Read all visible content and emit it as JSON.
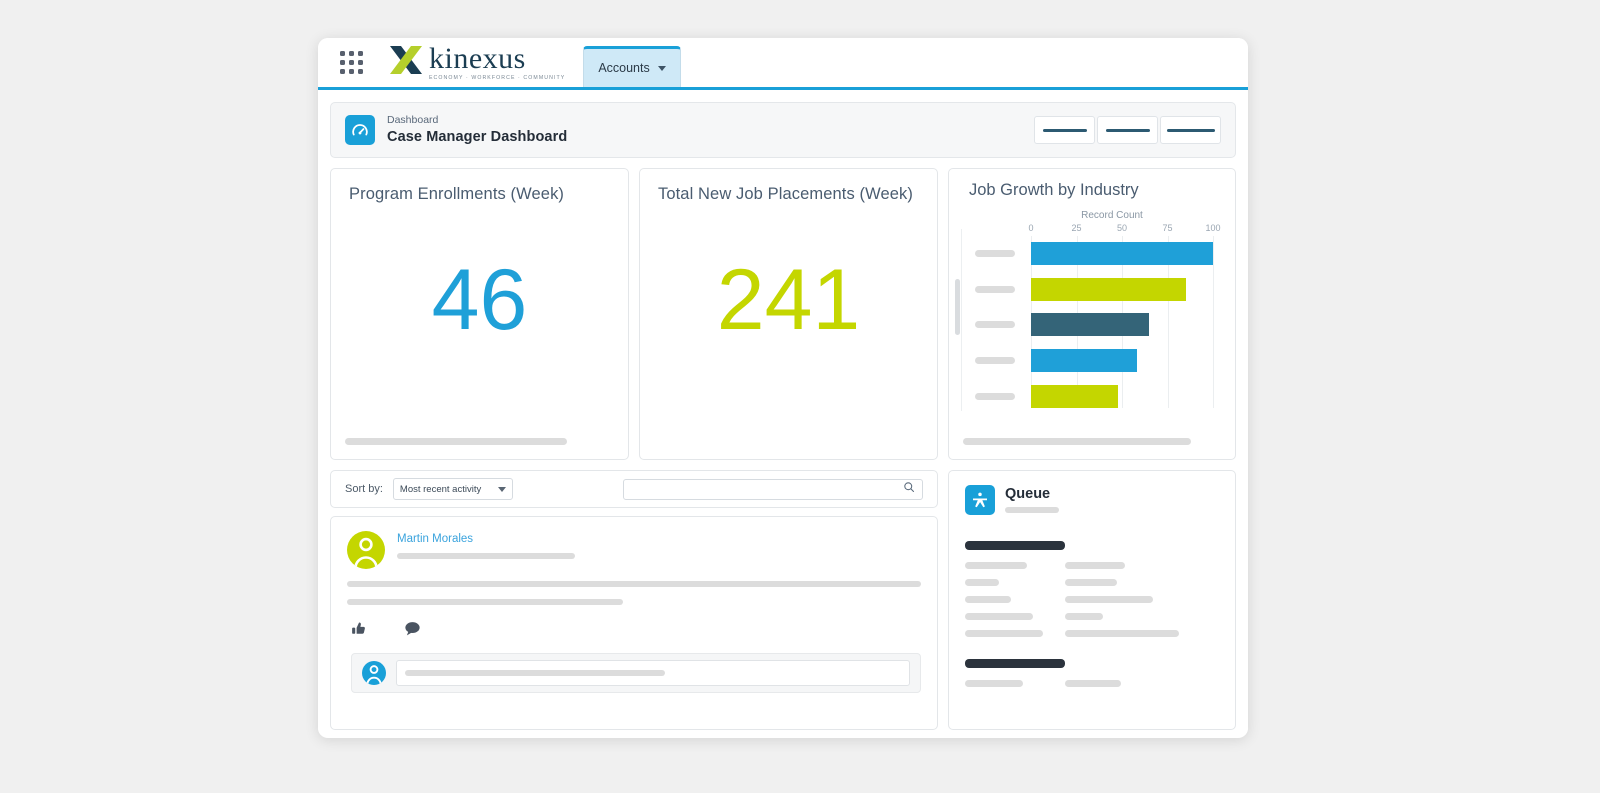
{
  "topbar": {
    "app_launcher_icon": "app-grid-icon",
    "brand_name": "kinexus",
    "brand_tagline": "ECONOMY · WORKFORCE · COMMUNITY",
    "tab_label": "Accounts",
    "tab_chevron_icon": "chevron-down-icon",
    "accent_color": "#19a0d8"
  },
  "dashboard_header": {
    "icon": "gauge-icon",
    "eyebrow": "Dashboard",
    "title": "Case Manager Dashboard",
    "action_buttons": [
      "",
      "",
      ""
    ]
  },
  "kpis": [
    {
      "title": "Program Enrollments (Week)",
      "value": "46",
      "color": "#1fa0d8"
    },
    {
      "title": "Total New Job Placements (Week)",
      "value": "241",
      "color": "#c4d600"
    }
  ],
  "chart_card": {
    "title": "Job Growth by Industry"
  },
  "chart_data": {
    "type": "bar",
    "title": "Job Growth by Industry",
    "orientation": "horizontal",
    "xlabel": "Record Count",
    "ylabel": "",
    "axis_title": "Record Count",
    "ticks": [
      0,
      25,
      50,
      75,
      100
    ],
    "xlim": [
      0,
      100
    ],
    "grid": true,
    "legend": "none",
    "categories": [
      "",
      "",
      "",
      "",
      ""
    ],
    "values": [
      100,
      85,
      65,
      58,
      48
    ],
    "colors": [
      "#1fa0d8",
      "#c4d600",
      "#346478",
      "#1fa0d8",
      "#c4d600"
    ]
  },
  "feed_toolbar": {
    "sort_label": "Sort by:",
    "sort_value": "Most recent activity",
    "sort_options": [
      "Most recent activity"
    ],
    "search_placeholder": "",
    "search_value": "",
    "search_icon": "search-icon"
  },
  "post": {
    "author": "Martin Morales",
    "avatar_color": "#c4d600",
    "like_icon": "thumbs-up-icon",
    "comment_icon": "comment-icon",
    "comment_avatar_color": "#19a0d8"
  },
  "queue": {
    "icon": "person-star-icon",
    "title": "Queue"
  }
}
